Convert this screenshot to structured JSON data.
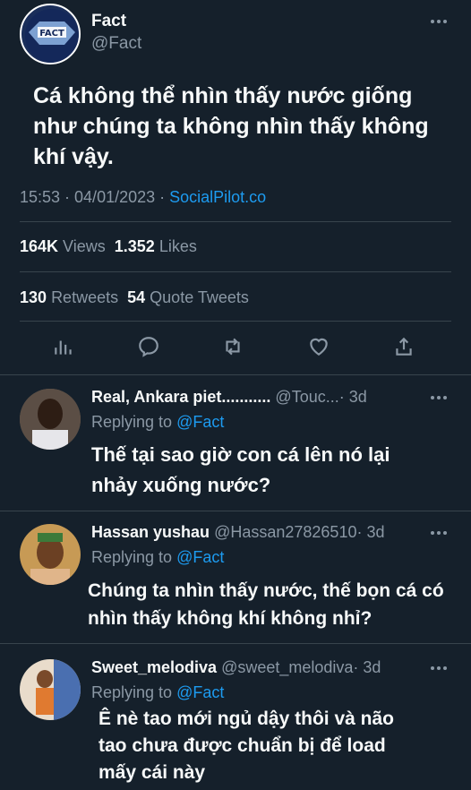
{
  "tweet": {
    "display_name": "Fact",
    "handle": "@Fact",
    "text_line1": "Cá không thể nhìn thấy nước giống",
    "text_line2": "như chúng ta không nhìn thấy không",
    "text_line3": "khí vậy.",
    "time": "15:53 · 04/01/2023 · ",
    "source": "SocialPilot.co",
    "views_count": "164K",
    "views_label": "Views",
    "likes_count": "1.352",
    "likes_label": "Likes",
    "retweets_count": "130",
    "retweets_label": "Retweets",
    "quotes_count": "54",
    "quotes_label": "Quote Tweets"
  },
  "replies": [
    {
      "name": "Real, Ankara piet...........",
      "handle": "@Touc...",
      "age": "· 3d",
      "replying_prefix": "Replying to ",
      "replying_to": "@Fact",
      "line1": "Thế tại sao giờ con cá lên nó lại",
      "line2": "nhảy xuống nước?"
    },
    {
      "name": "Hassan yushau",
      "handle": "@Hassan27826510",
      "age": "· 3d",
      "replying_prefix": "Replying to ",
      "replying_to": "@Fact",
      "line1": "Chúng ta nhìn thấy nước, thế bọn cá có",
      "line2": "nhìn thấy không khí không nhỉ?"
    },
    {
      "name": "Sweet_melodiva",
      "handle": "@sweet_melodiva",
      "age": "· 3d",
      "replying_prefix": "Replying to ",
      "replying_to": "@Fact",
      "line1": "Ê nè tao mới ngủ dậy thôi và não",
      "line2": "tao chưa được chuẩn bị để load",
      "line3": "mấy cái này"
    }
  ],
  "icons": [
    "analytics-icon",
    "reply-icon",
    "retweet-icon",
    "like-icon",
    "share-icon",
    "more-icon"
  ],
  "colors": {
    "background": "#15202b",
    "accent": "#1d9bf0",
    "muted": "#8b98a5",
    "text": "#f7f9f9"
  }
}
